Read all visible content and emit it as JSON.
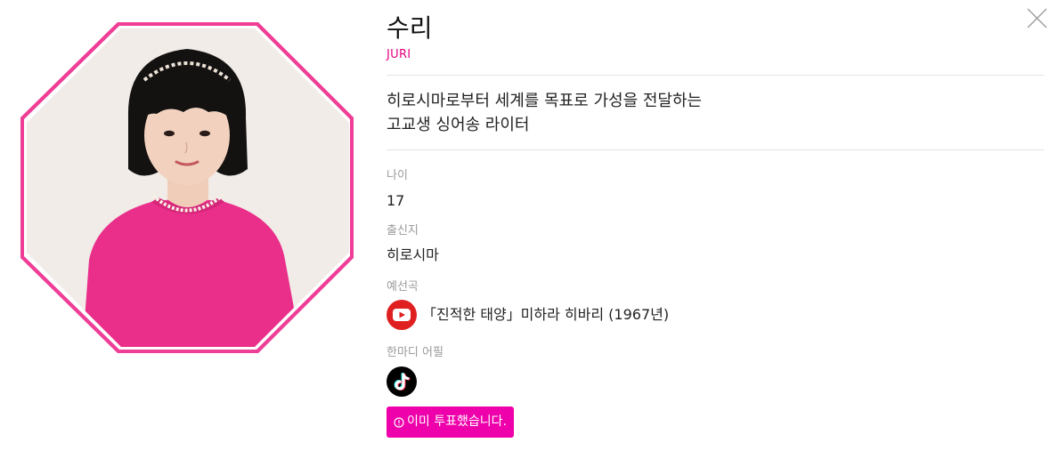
{
  "profile": {
    "name": "수리",
    "roman_name": "JURI",
    "catchphrase": [
      "히로시마로부터 세계를 목표로 가성을 전달하는",
      "고교생 싱어송 라이터"
    ],
    "age_label": "나이",
    "age": "17",
    "hometown_label": "출신지",
    "hometown": "히로시마",
    "song_label": "예선곡",
    "song": "「진적한 태양」미하라 히바리 (1967년)",
    "appeal_label": "한마디 어필"
  },
  "actions": {
    "vote_label": "이미 투표했습니다.",
    "youtube_icon": "youtube-icon",
    "tiktok_icon": "tiktok-icon",
    "close_icon": "close-icon"
  },
  "colors": {
    "accent": "#e4007f",
    "vote_button": "#ee00aa",
    "frame": "#ef3e96",
    "youtube": "#e02020",
    "tiktok": "#000000"
  }
}
